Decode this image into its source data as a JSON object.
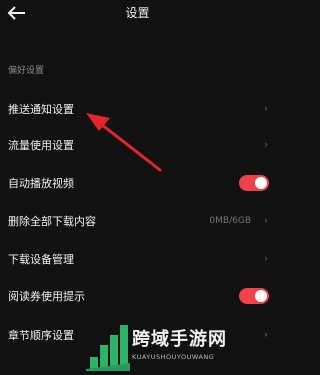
{
  "header": {
    "title": "设置",
    "back_icon": "arrow-left-icon"
  },
  "section_title": "偏好设置",
  "accent_color": "#f0424a",
  "rows": [
    {
      "label": "推送通知设置",
      "type": "chevron"
    },
    {
      "label": "流量使用设置",
      "type": "chevron"
    },
    {
      "label": "自动播放视频",
      "type": "toggle",
      "on": true
    },
    {
      "label": "删除全部下载内容",
      "type": "value",
      "value": "0MB/6GB"
    },
    {
      "label": "下载设备管理",
      "type": "chevron"
    },
    {
      "label": "阅读券使用提示",
      "type": "toggle",
      "on": true
    },
    {
      "label": "章节顺序设置",
      "type": "chevron"
    }
  ],
  "chevron_glyph": "›",
  "watermark": {
    "text": "跨域手游网",
    "sub": "KUAYUSHOUYOUWANG"
  }
}
